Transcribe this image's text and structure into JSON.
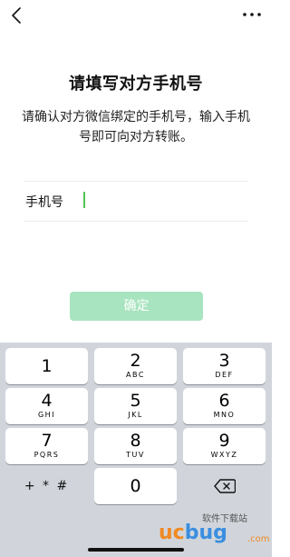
{
  "header": {
    "back_icon": "chevron-left-icon",
    "more_icon": "more-dots-icon"
  },
  "main": {
    "title": "请填写对方手机号",
    "subtitle": "请确认对方微信绑定的手机号，输入手机号即可向对方转账。",
    "phone_label": "手机号",
    "phone_value": "",
    "confirm_label": "确定"
  },
  "colors": {
    "confirm_disabled": "#a8e4bf",
    "caret": "#1aad19",
    "keyboard_bg": "#d1d5db"
  },
  "keyboard": {
    "keys": [
      {
        "num": "1",
        "letters": ""
      },
      {
        "num": "2",
        "letters": "ABC"
      },
      {
        "num": "3",
        "letters": "DEF"
      },
      {
        "num": "4",
        "letters": "GHI"
      },
      {
        "num": "5",
        "letters": "JKL"
      },
      {
        "num": "6",
        "letters": "MNO"
      },
      {
        "num": "7",
        "letters": "PQRS"
      },
      {
        "num": "8",
        "letters": "TUV"
      },
      {
        "num": "9",
        "letters": "WXYZ"
      }
    ],
    "symbols_label": "+ * #",
    "zero": "0",
    "delete_icon": "backspace-icon"
  },
  "watermark": {
    "top": "软件下载站",
    "brand_a": "uc",
    "brand_b": "bug",
    "suffix": ".com"
  }
}
